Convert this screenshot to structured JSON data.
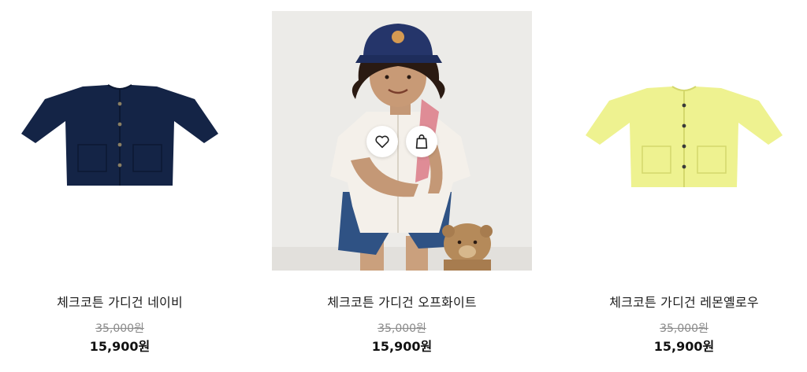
{
  "products": [
    {
      "name": "체크코튼 가디건 네이비",
      "original_price": "35,000원",
      "sale_price": "15,900원",
      "image": "navy-cardigan-flat",
      "color": "#142446"
    },
    {
      "name": "체크코튼 가디건 오프화이트",
      "original_price": "35,000원",
      "sale_price": "15,900원",
      "image": "child-wearing-offwhite-cardigan",
      "color": "#f4f0ea"
    },
    {
      "name": "체크코튼 가디건 레몬옐로우",
      "original_price": "35,000원",
      "sale_price": "15,900원",
      "image": "lemon-yellow-cardigan-flat",
      "color": "#eef290"
    }
  ],
  "hover_actions": {
    "wishlist_icon": "heart-icon",
    "cart_icon": "shopping-bag-icon"
  }
}
